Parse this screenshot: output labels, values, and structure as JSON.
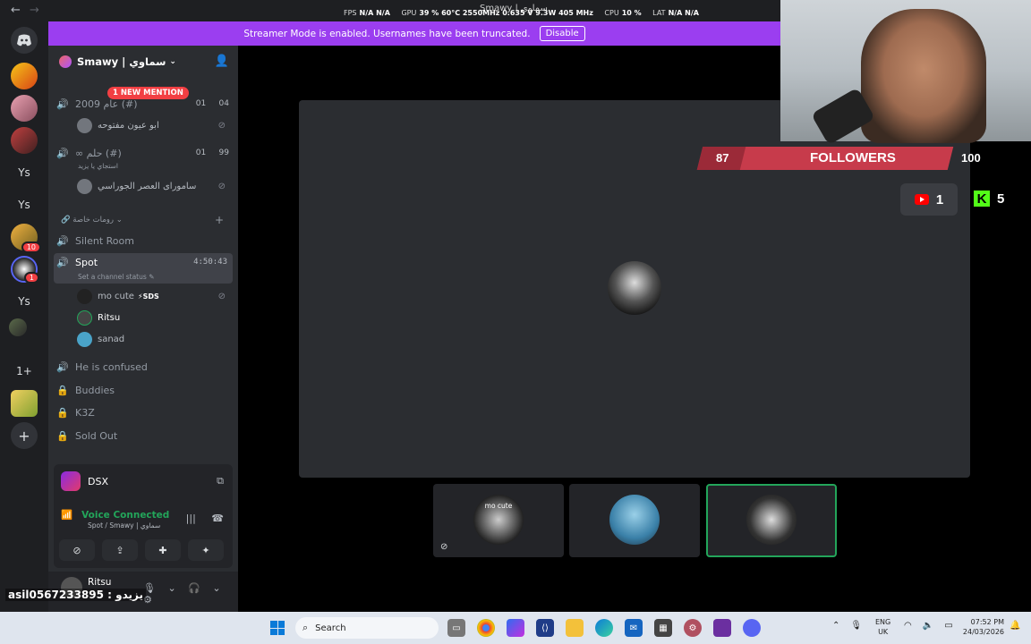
{
  "titlebar": {
    "back": "←",
    "forward": "→",
    "window_title": "Smawy | سماوي",
    "perf": [
      {
        "label": "FPS",
        "value": "N/A  N/A"
      },
      {
        "label": "GPU",
        "value": "39 %  60°C  2550MHz  0.635 V  9.3W  405 MHz"
      },
      {
        "label": "CPU",
        "value": "10 %"
      },
      {
        "label": "LAT",
        "value": "N/A  N/A"
      }
    ]
  },
  "banner": {
    "message": "Streamer Mode is enabled. Usernames have been truncated.",
    "button": "Disable"
  },
  "guilds": {
    "text_icons": [
      "Ys",
      "Ys",
      "Ys",
      "1+"
    ],
    "badges": [
      "10",
      "1"
    ],
    "add": "+"
  },
  "server": {
    "name": "Smawy | سماوي",
    "mention_pill": "1 NEW MENTION",
    "channels": [
      {
        "name": "عام 2009 (#)",
        "count_a": "01",
        "count_b": "04"
      },
      {
        "name": "∞ حلم (#)",
        "sub": "استجاي يا يزيد",
        "count_a": "01",
        "count_b": "99"
      }
    ],
    "users_top": [
      "ابو عيون مفتوحه",
      "سامورای العصر الجوراسي"
    ],
    "category": "رومات خاصة",
    "category_add": "+",
    "silent_room": "Silent Room",
    "spot": {
      "name": "Spot",
      "time": "4:50:43",
      "status": "Set a channel status"
    },
    "spot_users": [
      {
        "name": "mo cute",
        "tag": "SDS"
      },
      {
        "name": "Ritsu"
      },
      {
        "name": "sanad"
      }
    ],
    "other_channels": [
      "He is confused",
      "Buddies",
      "K3Z",
      "Sold Out"
    ]
  },
  "voice_panel": {
    "activity": "DSX",
    "status": "Voice Connected",
    "location": "Spot / Smawy | سماوي"
  },
  "user_bar": {
    "name": "Ritsu",
    "overlay_text": "asil0567233895 : يزيدو"
  },
  "stage": {
    "tile_label": "mo cute"
  },
  "stream_overlay": {
    "followers_current": "87",
    "followers_label": "FOLLOWERS",
    "followers_goal": "100",
    "followers_progress": 0.87,
    "youtube_count": "1",
    "kick_letter": "K",
    "kick_count": "5"
  },
  "taskbar": {
    "search_label": "Search",
    "lang_line1": "ENG",
    "lang_line2": "UK",
    "time": "07:52 PM",
    "date": "24/03/2026"
  },
  "colors": {
    "banner": "#9b3ef0",
    "voice_green": "#23a55a",
    "mention_red": "#f23f43",
    "follower_bar": "#c73b4b",
    "kick_green": "#53fc18"
  }
}
